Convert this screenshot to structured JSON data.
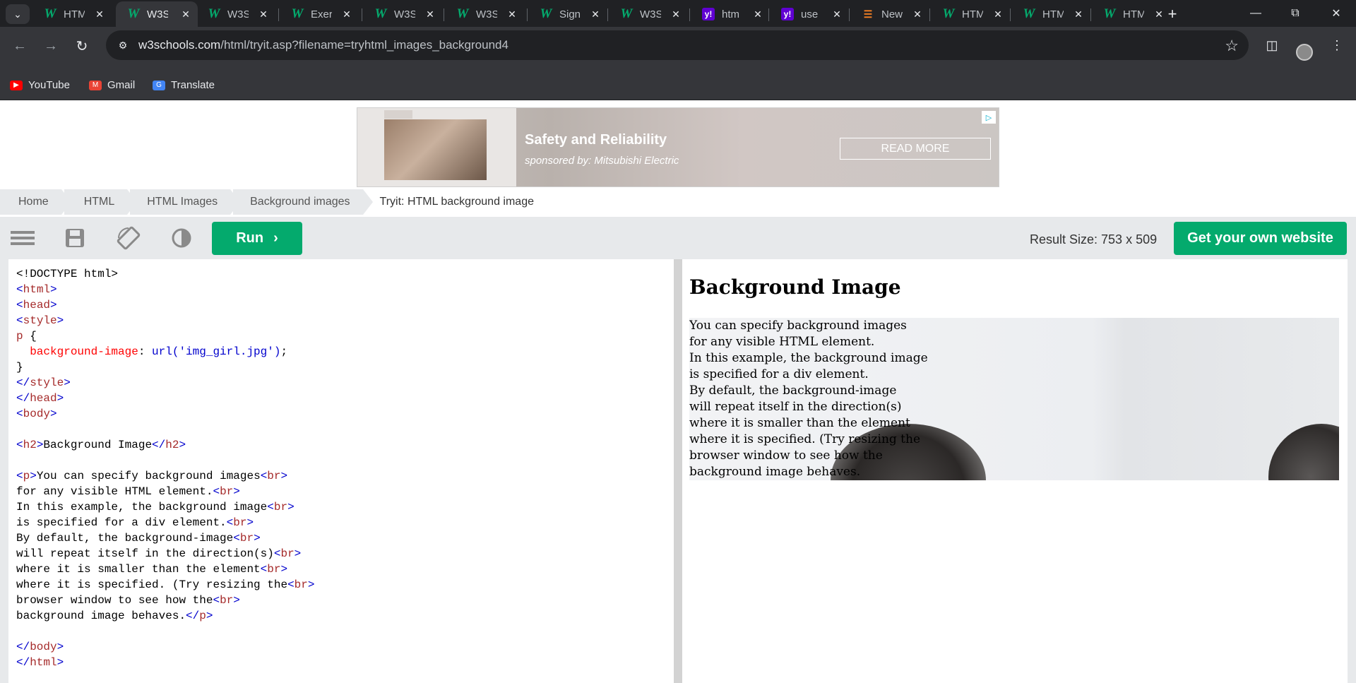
{
  "browser": {
    "tabs": [
      {
        "label": "HTM",
        "icon": "w3schools-icon"
      },
      {
        "label": "W3S",
        "icon": "w3schools-icon",
        "active": true
      },
      {
        "label": "W3S",
        "icon": "w3schools-icon"
      },
      {
        "label": "Exer",
        "icon": "w3schools-icon"
      },
      {
        "label": "W3S",
        "icon": "w3schools-icon"
      },
      {
        "label": "W3S",
        "icon": "w3schools-icon"
      },
      {
        "label": "Sign",
        "icon": "w3schools-icon"
      },
      {
        "label": "W3S",
        "icon": "w3schools-icon"
      },
      {
        "label": "htm",
        "icon": "yahoo-icon"
      },
      {
        "label": "use",
        "icon": "yahoo-icon"
      },
      {
        "label": "New",
        "icon": "stackoverflow-icon"
      },
      {
        "label": "HTM",
        "icon": "w3schools-icon"
      },
      {
        "label": "HTM",
        "icon": "w3schools-icon"
      },
      {
        "label": "HTM",
        "icon": "w3schools-icon"
      }
    ],
    "url_domain": "w3schools.com",
    "url_path": "/html/tryit.asp?filename=tryhtml_images_background4",
    "bookmarks": [
      {
        "label": "YouTube",
        "icon": "youtube-icon",
        "color": "#ff0000"
      },
      {
        "label": "Gmail",
        "icon": "gmail-icon",
        "color": "#ea4335"
      },
      {
        "label": "Translate",
        "icon": "translate-icon",
        "color": "#4285f4"
      }
    ]
  },
  "ad": {
    "title": "Safety and Reliability",
    "subtitle": "sponsored by: Mitsubishi Electric",
    "button": "READ MORE"
  },
  "breadcrumb": [
    "Home",
    "HTML",
    "HTML Images",
    "Background images",
    "Tryit: HTML background image"
  ],
  "editor_bar": {
    "run_label": "Run",
    "result_size": "Result Size: 753 x 509",
    "get_website": "Get your own website"
  },
  "code_lines": [
    [
      [
        "tx",
        "<!DOCTYPE html>"
      ]
    ],
    [
      [
        "br",
        "<"
      ],
      [
        "tg",
        "html"
      ],
      [
        "br",
        ">"
      ]
    ],
    [
      [
        "br",
        "<"
      ],
      [
        "tg",
        "head"
      ],
      [
        "br",
        ">"
      ]
    ],
    [
      [
        "br",
        "<"
      ],
      [
        "tg",
        "style"
      ],
      [
        "br",
        ">"
      ]
    ],
    [
      [
        "tg",
        "p"
      ],
      [
        "tx",
        " {"
      ]
    ],
    [
      [
        "tx",
        "  "
      ],
      [
        "pr",
        "background-image"
      ],
      [
        "tx",
        ": "
      ],
      [
        "vl",
        "url('img_girl.jpg')"
      ],
      [
        "tx",
        ";"
      ]
    ],
    [
      [
        "tx",
        "}"
      ]
    ],
    [
      [
        "br",
        "</"
      ],
      [
        "tg",
        "style"
      ],
      [
        "br",
        ">"
      ]
    ],
    [
      [
        "br",
        "</"
      ],
      [
        "tg",
        "head"
      ],
      [
        "br",
        ">"
      ]
    ],
    [
      [
        "br",
        "<"
      ],
      [
        "tg",
        "body"
      ],
      [
        "br",
        ">"
      ]
    ],
    [],
    [
      [
        "br",
        "<"
      ],
      [
        "tg",
        "h2"
      ],
      [
        "br",
        ">"
      ],
      [
        "tx",
        "Background Image"
      ],
      [
        "br",
        "</"
      ],
      [
        "tg",
        "h2"
      ],
      [
        "br",
        ">"
      ]
    ],
    [],
    [
      [
        "br",
        "<"
      ],
      [
        "tg",
        "p"
      ],
      [
        "br",
        ">"
      ],
      [
        "tx",
        "You can specify background images"
      ],
      [
        "br",
        "<"
      ],
      [
        "tg",
        "br"
      ],
      [
        "br",
        ">"
      ]
    ],
    [
      [
        "tx",
        "for any visible HTML element."
      ],
      [
        "br",
        "<"
      ],
      [
        "tg",
        "br"
      ],
      [
        "br",
        ">"
      ]
    ],
    [
      [
        "tx",
        "In this example, the background image"
      ],
      [
        "br",
        "<"
      ],
      [
        "tg",
        "br"
      ],
      [
        "br",
        ">"
      ]
    ],
    [
      [
        "tx",
        "is specified for a div element."
      ],
      [
        "br",
        "<"
      ],
      [
        "tg",
        "br"
      ],
      [
        "br",
        ">"
      ]
    ],
    [
      [
        "tx",
        "By default, the background-image"
      ],
      [
        "br",
        "<"
      ],
      [
        "tg",
        "br"
      ],
      [
        "br",
        ">"
      ]
    ],
    [
      [
        "tx",
        "will repeat itself in the direction(s)"
      ],
      [
        "br",
        "<"
      ],
      [
        "tg",
        "br"
      ],
      [
        "br",
        ">"
      ]
    ],
    [
      [
        "tx",
        "where it is smaller than the element"
      ],
      [
        "br",
        "<"
      ],
      [
        "tg",
        "br"
      ],
      [
        "br",
        ">"
      ]
    ],
    [
      [
        "tx",
        "where it is specified. (Try resizing the"
      ],
      [
        "br",
        "<"
      ],
      [
        "tg",
        "br"
      ],
      [
        "br",
        ">"
      ]
    ],
    [
      [
        "tx",
        "browser window to see how the"
      ],
      [
        "br",
        "<"
      ],
      [
        "tg",
        "br"
      ],
      [
        "br",
        ">"
      ]
    ],
    [
      [
        "tx",
        "background image behaves."
      ],
      [
        "br",
        "</"
      ],
      [
        "tg",
        "p"
      ],
      [
        "br",
        ">"
      ]
    ],
    [],
    [
      [
        "br",
        "</"
      ],
      [
        "tg",
        "body"
      ],
      [
        "br",
        ">"
      ]
    ],
    [
      [
        "br",
        "</"
      ],
      [
        "tg",
        "html"
      ],
      [
        "br",
        ">"
      ]
    ]
  ],
  "result": {
    "heading": "Background Image",
    "lines": [
      "You can specify background images",
      "for any visible HTML element.",
      "In this example, the background image",
      "is specified for a div element.",
      "By default, the background-image",
      "will repeat itself in the direction(s)",
      "where it is smaller than the element",
      "where it is specified. (Try resizing the",
      "browser window to see how the",
      "background image behaves."
    ]
  }
}
